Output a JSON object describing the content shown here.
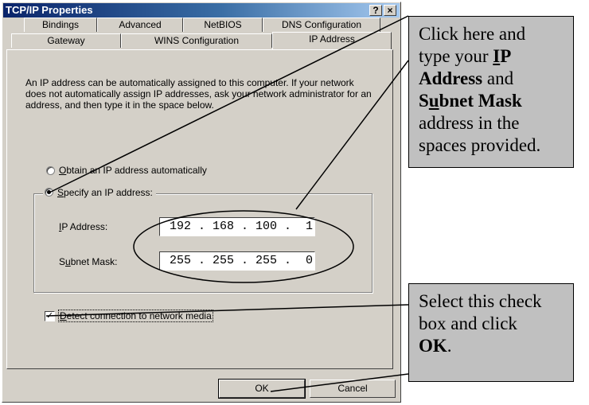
{
  "window": {
    "title": "TCP/IP Properties",
    "help_label": "?",
    "close_label": "×"
  },
  "tabs_back": [
    {
      "label": "Bindings"
    },
    {
      "label": "Advanced"
    },
    {
      "label": "NetBIOS"
    },
    {
      "label": "DNS Configuration"
    }
  ],
  "tabs_front": [
    {
      "label": "Gateway"
    },
    {
      "label": "WINS Configuration"
    },
    {
      "label": "IP Address",
      "active": true
    }
  ],
  "description": "An IP address can be automatically assigned to this computer. If your network does not automatically assign IP addresses, ask your network administrator for an address, and then type it in the space below.",
  "options": {
    "obtain_auto": {
      "accel": "O",
      "label_rest": "btain an IP address automatically",
      "selected": false
    },
    "specify": {
      "accel": "S",
      "label_rest": "pecify an IP address:",
      "selected": true
    }
  },
  "fields": {
    "ip_address": {
      "label_accel": "I",
      "label_rest": "P Address:",
      "value": "192 . 168 . 100 .  1"
    },
    "subnet_mask": {
      "label_pre": "S",
      "label_accel": "u",
      "label_rest": "bnet Mask:",
      "value": "255 . 255 . 255 .  0"
    }
  },
  "detect_checkbox": {
    "accel": "D",
    "label_rest": "etect connection to network media",
    "checked": true,
    "check_glyph": "✓"
  },
  "buttons": {
    "ok": "OK",
    "cancel": "Cancel"
  },
  "callouts": {
    "top": {
      "line1": "Click here and",
      "line2_pre": "type your ",
      "line2_accel": "I",
      "line2_bold": "P",
      "line3": "Address",
      "line3_post": " and",
      "line4_accel": "S",
      "line4_u": "u",
      "line4_bold": "bnet Mask",
      "line5": "address in the",
      "line6": "spaces provided."
    },
    "bottom": {
      "line1": "Select this check",
      "line2": "box and click",
      "line3_bold": "OK",
      "line3_post": "."
    }
  }
}
